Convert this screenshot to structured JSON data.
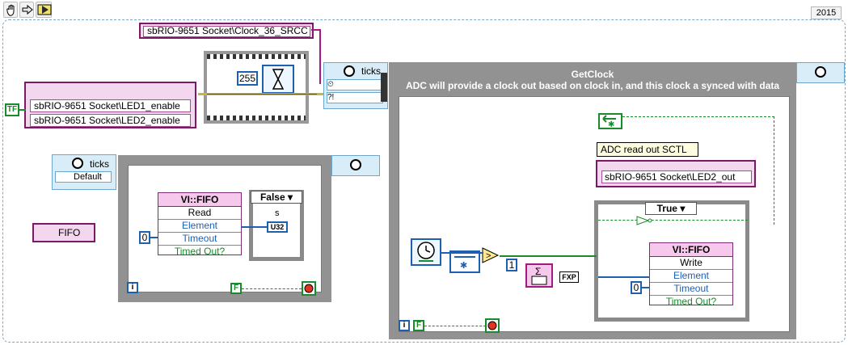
{
  "toolbar": {
    "icons": [
      "hand-icon",
      "arrow-right-icon",
      "run-icon"
    ],
    "version": "2015"
  },
  "top_clock": {
    "resource": "sbRIO-9651 Socket\\Clock_36_SRCC"
  },
  "left_leds": {
    "items": [
      "sbRIO-9651 Socket\\LED1_enable",
      "sbRIO-9651 Socket\\LED2_enable"
    ],
    "bool_label": "TF"
  },
  "wait_node": {
    "value": "255"
  },
  "timed_top": {
    "label": "ticks",
    "row2": "?!"
  },
  "timed_left": {
    "label": "ticks",
    "default_label": "Default"
  },
  "fifo_ref": {
    "label": "FIFO"
  },
  "left_fifo": {
    "title": "VI::FIFO",
    "rows": [
      "Read",
      "Element",
      "Timeout",
      "Timed Out?"
    ],
    "timeout_value": "0"
  },
  "left_case": {
    "label": "False",
    "output_label": "s",
    "type": "U32"
  },
  "left_loop_footer": {
    "index": "i",
    "bool": "F"
  },
  "getclock": {
    "title": "GetClock",
    "subtitle": "ADC will provide a clock out based on clock in, and this clock a synced with data"
  },
  "adc_label": {
    "text": "ADC read out SCTL"
  },
  "led2_out": {
    "label": "sbRIO-9651 Socket\\LED2_out"
  },
  "right_case": {
    "label": "True"
  },
  "right_fifo": {
    "title": "VI::FIFO",
    "rows": [
      "Write",
      "Element",
      "Timeout",
      "Timed Out?"
    ],
    "timeout_value": "0"
  },
  "const_one": {
    "value": "1"
  },
  "fxp": {
    "label": "FXP"
  },
  "right_footer": {
    "index": "i",
    "bool": "F"
  }
}
